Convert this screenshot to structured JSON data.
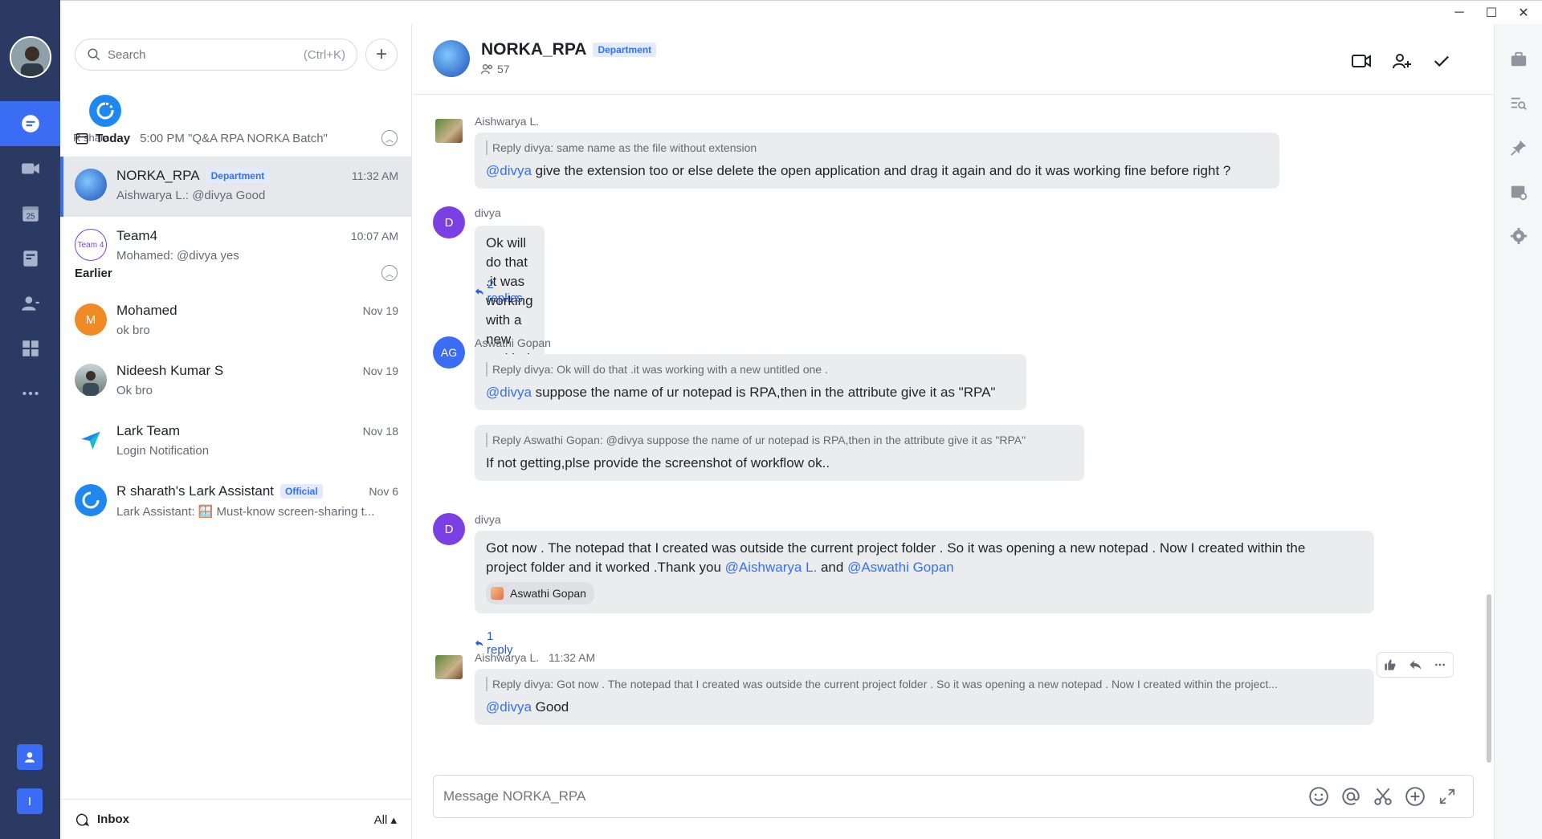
{
  "window": {
    "minimize": "─",
    "maximize": "☐",
    "close": "✕"
  },
  "rail": {
    "items": [
      "chat-icon",
      "video-icon",
      "calendar-icon",
      "docs-icon",
      "contacts-icon",
      "apps-icon",
      "more-icon"
    ],
    "calendar_day": "25",
    "bottom_user_initial": "I"
  },
  "search": {
    "placeholder": "Search",
    "shortcut": "(Ctrl+K)"
  },
  "pinned": {
    "name": "R shara"
  },
  "today": {
    "title": "Today",
    "sub": "5:00 PM \"Q&A RPA NORKA Batch\""
  },
  "earlier": {
    "title": "Earlier"
  },
  "conversations": [
    {
      "name": "NORKA_RPA",
      "tag": "Department",
      "preview": "Aishwarya L.: @divya Good",
      "time": "11:32 AM",
      "color": "#1e4fb8"
    },
    {
      "name": "Team4",
      "tag": "",
      "preview": "Mohamed: @divya yes",
      "time": "10:07 AM",
      "avatar_text": "Team 4",
      "color": "#7b3fe4"
    },
    {
      "name": "Mohamed",
      "tag": "",
      "preview": "ok bro",
      "time": "Nov 19",
      "avatar_text": "M",
      "color": "#f08a24"
    },
    {
      "name": "Nideesh Kumar S",
      "tag": "",
      "preview": "Ok bro",
      "time": "Nov 19",
      "color": "#8a9a8a"
    },
    {
      "name": "Lark Team",
      "tag": "",
      "preview": "Login Notification",
      "time": "Nov 18",
      "color": "#ffffff"
    },
    {
      "name": "R sharath's Lark Assistant",
      "tag": "Official",
      "preview": "Lark Assistant: 🪟 Must-know screen-sharing t...",
      "time": "Nov 6",
      "color": "#1e88f0"
    }
  ],
  "inbox": {
    "label": "Inbox",
    "filter": "All ▴"
  },
  "chat": {
    "name": "NORKA_RPA",
    "tag": "Department",
    "members": "57",
    "composer_placeholder": "Message NORKA_RPA"
  },
  "messages": [
    {
      "sender": "Aishwarya L.",
      "quote": "Reply divya:  same name as the file without extension",
      "mention": "@divya",
      "text": " give the extension too or else delete the open application and drag it again and do it was working fine before right ?"
    },
    {
      "sender": "divya",
      "avatar": "D",
      "text": "Ok will do that .it was  working with a new untitled one .",
      "replies": "2 replies"
    },
    {
      "sender": "Aswathi Gopan",
      "avatar": "AG",
      "quote": "Reply divya:  Ok will do that .it was working with a new untitled one .",
      "mention": "@divya",
      "text": " suppose the name of ur notepad is RPA,then in the attribute give it as \"RPA\"",
      "quote2": "Reply Aswathi Gopan:  @divya suppose the name of ur notepad is RPA,then in the attribute give it as \"RPA\"",
      "text2": "If not getting,plse provide the screenshot of workflow ok.."
    },
    {
      "sender": "divya",
      "avatar": "D",
      "text_line1": "Got now . The notepad that I created was outside the current project folder . So it was opening a new notepad . Now I created within the",
      "text_line2_pre": "project folder and it worked .Thank you ",
      "mention1": "@Aishwarya L.",
      "mid": " and ",
      "mention2": "@Aswathi Gopan",
      "reaction": "Aswathi Gopan",
      "replies": "1 reply"
    },
    {
      "sender": "Aishwarya L.",
      "time": "11:32 AM",
      "quote": "Reply divya:  Got now . The notepad that I created was outside the current project folder . So it was opening a new notepad . Now I created within the project...",
      "mention": "@divya",
      "text": " Good"
    }
  ],
  "colors": {
    "accent": "#3a6cf4",
    "rail": "#2b3a63",
    "bubble": "#ebeced",
    "mention": "#3370ff"
  }
}
